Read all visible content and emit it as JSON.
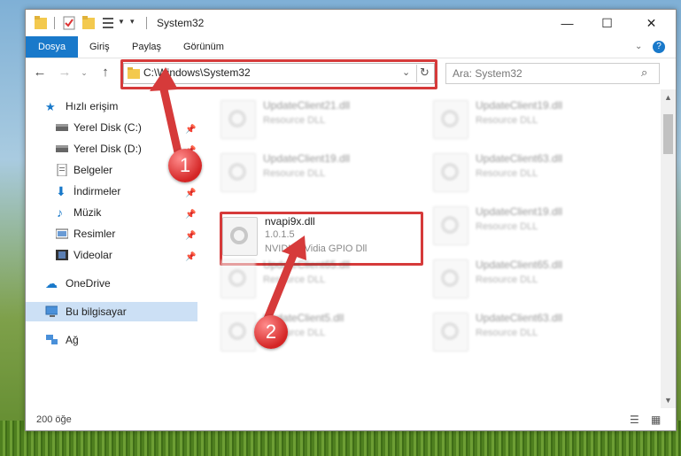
{
  "window": {
    "title": "System32",
    "controls": {
      "minimize": "—",
      "maximize": "☐",
      "close": "✕"
    }
  },
  "ribbon": {
    "tabs": [
      "Dosya",
      "Giriş",
      "Paylaş",
      "Görünüm"
    ],
    "help": "?"
  },
  "address": {
    "path": "C:\\Windows\\System32",
    "search_placeholder": "Ara: System32"
  },
  "sidebar": {
    "quick_access": "Hızlı erişim",
    "items": [
      {
        "label": "Yerel Disk (C:)",
        "icon": "drive-icon",
        "pinned": true
      },
      {
        "label": "Yerel Disk (D:)",
        "icon": "drive-icon",
        "pinned": true
      },
      {
        "label": "Belgeler",
        "icon": "documents-icon",
        "pinned": true
      },
      {
        "label": "İndirmeler",
        "icon": "downloads-icon",
        "pinned": true
      },
      {
        "label": "Müzik",
        "icon": "music-icon",
        "pinned": true
      },
      {
        "label": "Resimler",
        "icon": "pictures-icon",
        "pinned": true
      },
      {
        "label": "Videolar",
        "icon": "videos-icon",
        "pinned": true
      }
    ],
    "onedrive": "OneDrive",
    "this_pc": "Bu bilgisayar",
    "network": "Ağ"
  },
  "files": [
    {
      "name": "UpdateClient21.dll",
      "desc": "Resource DLL"
    },
    {
      "name": "UpdateClient19.dll",
      "desc": "Resource DLL"
    },
    {
      "name": "UpdateClient19.dll",
      "desc": "Resource DLL"
    },
    {
      "name": "UpdateClient63.dll",
      "desc": "Resource DLL"
    },
    {
      "name": "UpdateClient19.dll",
      "desc": "Resource DLL"
    },
    {
      "name": "UpdateClient65.dll",
      "desc": "Resource DLL"
    },
    {
      "name": "UpdateClient65.dll",
      "desc": "Resource DLL"
    },
    {
      "name": "UpdateClient5.dll",
      "desc": "Resource DLL"
    },
    {
      "name": "UpdateClient63.dll",
      "desc": "Resource DLL"
    }
  ],
  "focus_file": {
    "name": "nvapi9x.dll",
    "version": "1.0.1.5",
    "description": "NVIDIANVidia GPIO Dll"
  },
  "status": {
    "count": "200 öğe"
  },
  "annotations": {
    "step1": "1",
    "step2": "2",
    "color": "#d63a3a"
  }
}
